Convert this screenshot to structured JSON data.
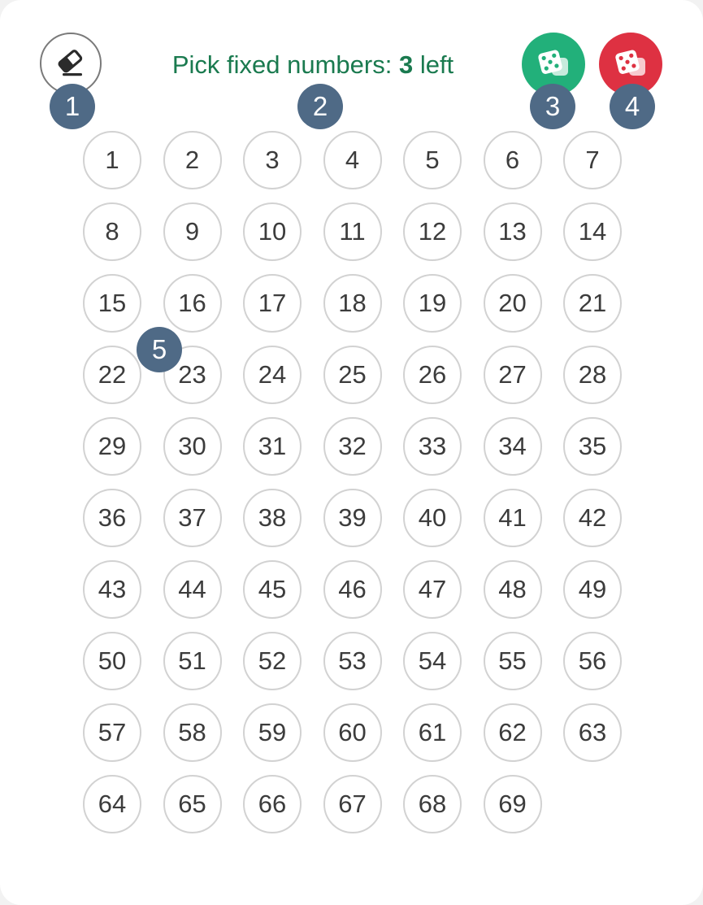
{
  "header": {
    "prefix": "Pick fixed numbers:",
    "count": "3",
    "suffix": "left"
  },
  "buttons": {
    "clear_icon": "eraser-icon",
    "quick_pick_green_icon": "dice-icon",
    "quick_pick_red_icon": "dice-icon",
    "green_color": "#22b07a",
    "red_color": "#de3142"
  },
  "markers": [
    "1",
    "2",
    "3",
    "4",
    "5"
  ],
  "numbers": [
    "1",
    "2",
    "3",
    "4",
    "5",
    "6",
    "7",
    "8",
    "9",
    "10",
    "11",
    "12",
    "13",
    "14",
    "15",
    "16",
    "17",
    "18",
    "19",
    "20",
    "21",
    "22",
    "23",
    "24",
    "25",
    "26",
    "27",
    "28",
    "29",
    "30",
    "31",
    "32",
    "33",
    "34",
    "35",
    "36",
    "37",
    "38",
    "39",
    "40",
    "41",
    "42",
    "43",
    "44",
    "45",
    "46",
    "47",
    "48",
    "49",
    "50",
    "51",
    "52",
    "53",
    "54",
    "55",
    "56",
    "57",
    "58",
    "59",
    "60",
    "61",
    "62",
    "63",
    "64",
    "65",
    "66",
    "67",
    "68",
    "69"
  ]
}
